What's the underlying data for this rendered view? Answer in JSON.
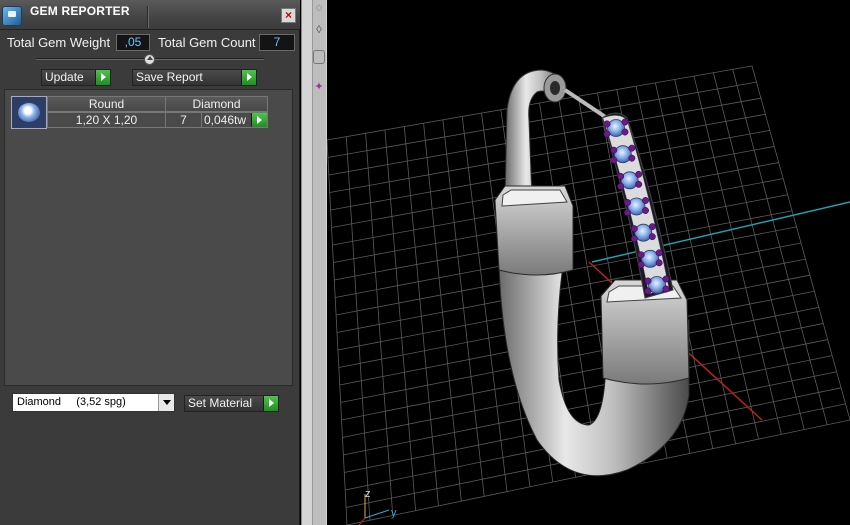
{
  "panel": {
    "title": "GEM REPORTER",
    "total_weight_label": "Total Gem Weight",
    "total_weight_value": ",05",
    "total_count_label": "Total Gem Count",
    "total_count_value": "7",
    "update_label": "Update",
    "save_report_label": "Save Report",
    "table": {
      "header": [
        "Round",
        "Diamond"
      ],
      "row": {
        "size": "1,20 X 1,20",
        "count": "7",
        "weight": "0,046tw"
      }
    },
    "material_select_value": "Diamond     (3,52 spg)",
    "set_material_label": "Set Material"
  },
  "viewport": {
    "axis_z": "z",
    "axis_y": "y"
  },
  "colors": {
    "accent_value": "#6fc4ff",
    "play_green": "#2fa82f",
    "gem_blue": "#8fb3ea",
    "gem_purple": "#6a1a8a",
    "grid_red": "#c02020",
    "grid_cyan": "#20a0b0"
  },
  "icons": [
    "gem-reporter-app-icon",
    "close-icon",
    "play-arrow-icon",
    "dropdown-arrow-icon",
    "slider-knob-icon"
  ]
}
